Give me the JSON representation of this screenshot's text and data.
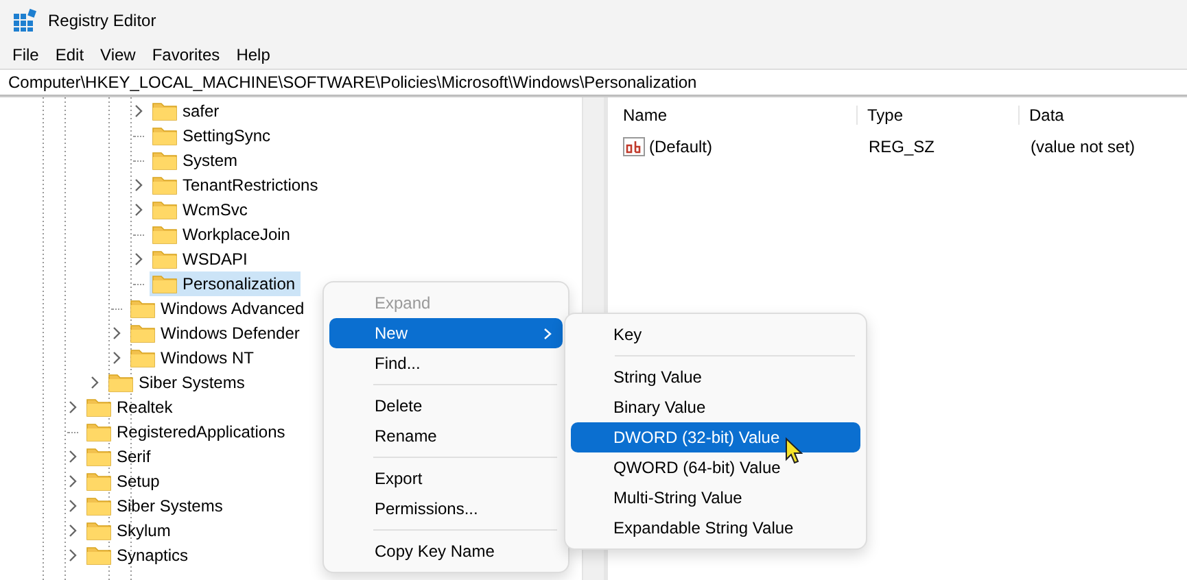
{
  "window": {
    "title": "Registry Editor"
  },
  "menu_bar": [
    "File",
    "Edit",
    "View",
    "Favorites",
    "Help"
  ],
  "address_bar": {
    "value": "Computer\\HKEY_LOCAL_MACHINE\\SOFTWARE\\Policies\\Microsoft\\Windows\\Personalization"
  },
  "tree": {
    "items": [
      {
        "children": [
          {
            "children": [
              {
                "children": [
                  {
                    "label": "safer",
                    "expandable": true,
                    "selected": false
                  },
                  {
                    "label": "SettingSync",
                    "expandable": false,
                    "selected": false
                  },
                  {
                    "label": "System",
                    "expandable": false,
                    "selected": false
                  },
                  {
                    "label": "TenantRestrictions",
                    "expandable": true,
                    "selected": false
                  },
                  {
                    "label": "WcmSvc",
                    "expandable": true,
                    "selected": false
                  },
                  {
                    "label": "WorkplaceJoin",
                    "expandable": false,
                    "selected": false
                  },
                  {
                    "label": "WSDAPI",
                    "expandable": true,
                    "selected": false
                  },
                  {
                    "label": "Personalization",
                    "expandable": false,
                    "selected": true
                  }
                ]
              },
              {
                "label": "Windows Advanced",
                "expandable": false,
                "selected": false
              },
              {
                "label": "Windows Defender",
                "expandable": true,
                "selected": false
              },
              {
                "label": "Windows NT",
                "expandable": true,
                "selected": false
              }
            ]
          },
          {
            "label": "Siber Systems",
            "expandable": true,
            "selected": false
          }
        ]
      },
      {
        "label": "Realtek",
        "expandable": true,
        "selected": false
      },
      {
        "label": "RegisteredApplications",
        "expandable": false,
        "selected": false
      },
      {
        "label": "Serif",
        "expandable": true,
        "selected": false
      },
      {
        "label": "Setup",
        "expandable": true,
        "selected": false
      },
      {
        "label": "Siber Systems",
        "expandable": true,
        "selected": false
      },
      {
        "label": "Skylum",
        "expandable": true,
        "selected": false
      },
      {
        "label": "Synaptics",
        "expandable": true,
        "selected": false
      }
    ]
  },
  "values_table": {
    "columns": [
      "Name",
      "Type",
      "Data"
    ],
    "rows": [
      {
        "name": "(Default)",
        "type": "REG_SZ",
        "data": "(value not set)"
      }
    ]
  },
  "context_menu": {
    "items": [
      {
        "kind": "item",
        "label": "Expand",
        "disabled": true,
        "selected": false,
        "has_submenu": false
      },
      {
        "kind": "item",
        "label": "New",
        "disabled": false,
        "selected": true,
        "has_submenu": true
      },
      {
        "kind": "item",
        "label": "Find...",
        "disabled": false,
        "selected": false,
        "has_submenu": false
      },
      {
        "kind": "separator"
      },
      {
        "kind": "item",
        "label": "Delete",
        "disabled": false,
        "selected": false,
        "has_submenu": false
      },
      {
        "kind": "item",
        "label": "Rename",
        "disabled": false,
        "selected": false,
        "has_submenu": false
      },
      {
        "kind": "separator"
      },
      {
        "kind": "item",
        "label": "Export",
        "disabled": false,
        "selected": false,
        "has_submenu": false
      },
      {
        "kind": "item",
        "label": "Permissions...",
        "disabled": false,
        "selected": false,
        "has_submenu": false
      },
      {
        "kind": "separator"
      },
      {
        "kind": "item",
        "label": "Copy Key Name",
        "disabled": false,
        "selected": false,
        "has_submenu": false
      }
    ]
  },
  "submenu": {
    "items": [
      {
        "kind": "item",
        "label": "Key",
        "selected": false
      },
      {
        "kind": "separator"
      },
      {
        "kind": "item",
        "label": "String Value",
        "selected": false
      },
      {
        "kind": "item",
        "label": "Binary Value",
        "selected": false
      },
      {
        "kind": "item",
        "label": "DWORD (32-bit) Value",
        "selected": true
      },
      {
        "kind": "item",
        "label": "QWORD (64-bit) Value",
        "selected": false
      },
      {
        "kind": "item",
        "label": "Multi-String Value",
        "selected": false
      },
      {
        "kind": "item",
        "label": "Expandable String Value",
        "selected": false
      }
    ]
  }
}
